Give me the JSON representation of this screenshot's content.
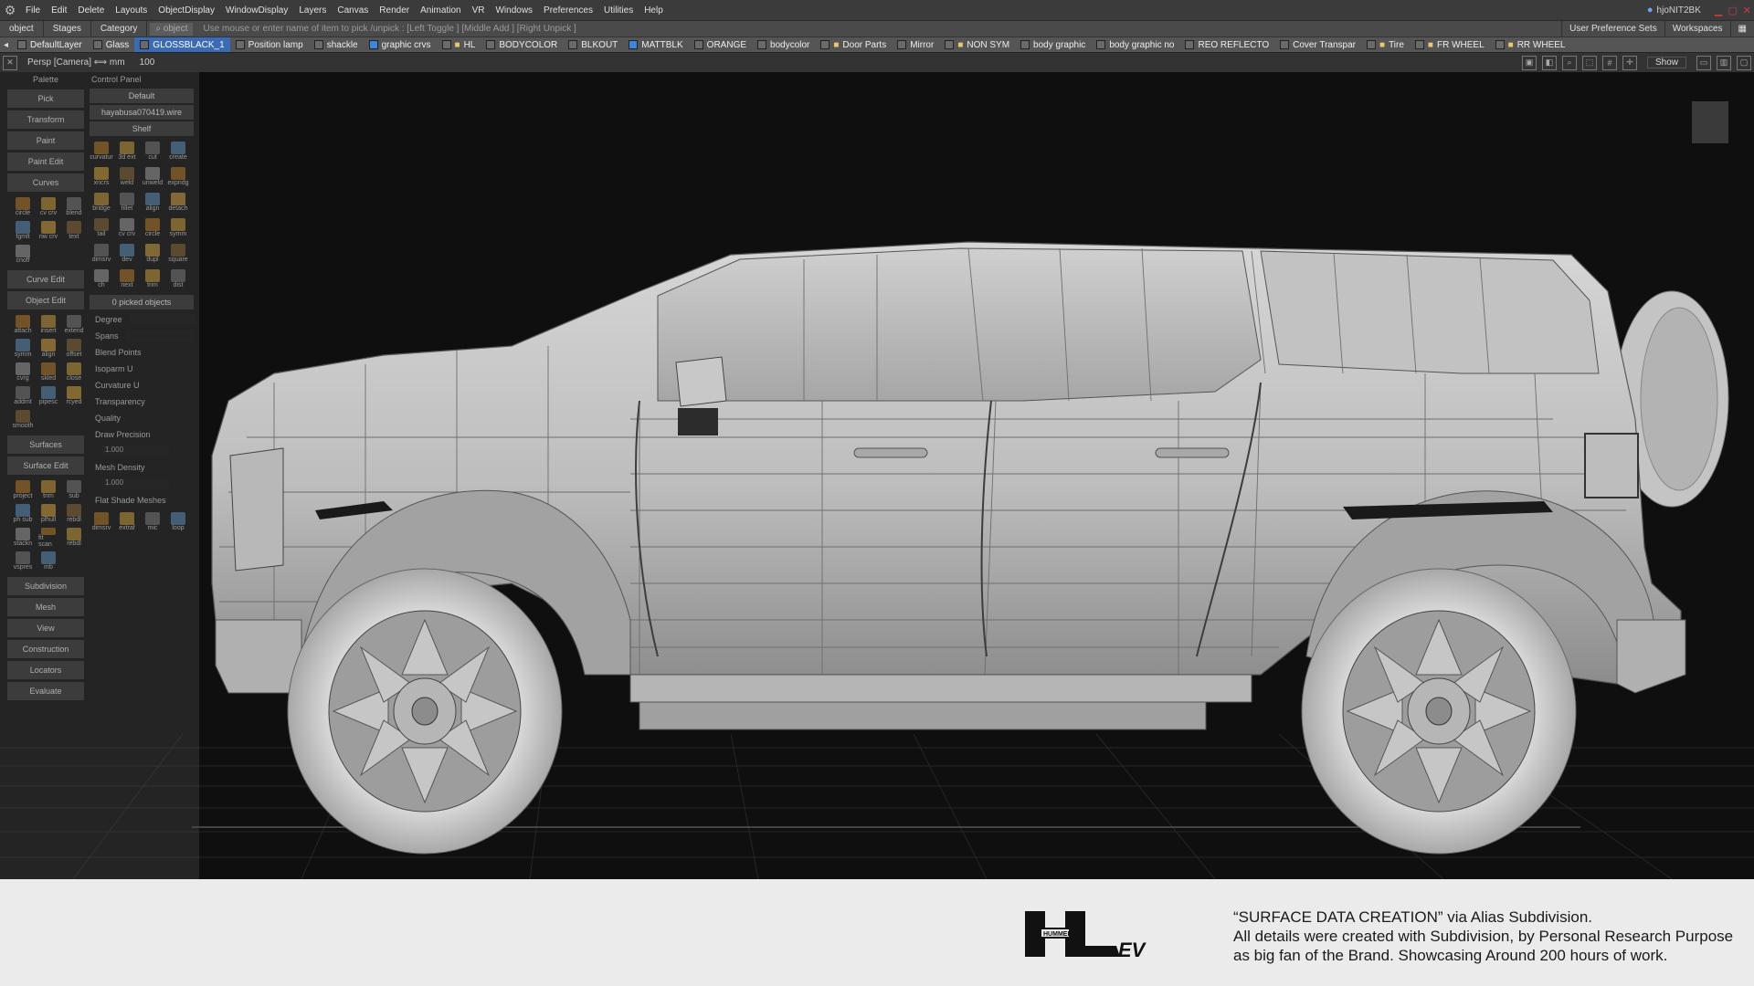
{
  "menubar": {
    "app_icon": "alias-app-icon",
    "items": [
      "File",
      "Edit",
      "Delete",
      "Layouts",
      "ObjectDisplay",
      "WindowDisplay",
      "Layers",
      "Canvas",
      "Render",
      "Animation",
      "VR",
      "Windows",
      "Preferences",
      "Utilities",
      "Help"
    ],
    "user": "hjoNIT2BK"
  },
  "statusbar": {
    "object_label": "object",
    "stages": "Stages",
    "category": "Category",
    "object_field": "object",
    "prompt": "Use mouse or enter name of item to pick /unpick : [Left Toggle ] [Middle Add ] [Right Unpick ]",
    "user_preference_sets": "User Preference Sets",
    "workspaces": "Workspaces"
  },
  "layers": [
    {
      "name": "DefaultLayer",
      "cb": "gray",
      "folder": false,
      "active": false
    },
    {
      "name": "Glass",
      "cb": "gray",
      "folder": false,
      "active": false
    },
    {
      "name": "GLOSSBLACK_1",
      "cb": "gray",
      "folder": false,
      "active": true
    },
    {
      "name": "Position lamp",
      "cb": "gray",
      "folder": false,
      "active": false
    },
    {
      "name": "shackle",
      "cb": "gray",
      "folder": false,
      "active": false
    },
    {
      "name": "graphic crvs",
      "cb": "blue",
      "folder": false,
      "active": false
    },
    {
      "name": "HL",
      "cb": "gray",
      "folder": true,
      "active": false
    },
    {
      "name": "BODYCOLOR",
      "cb": "gray",
      "folder": false,
      "active": false
    },
    {
      "name": "BLKOUT",
      "cb": "gray",
      "folder": false,
      "active": false
    },
    {
      "name": "MATTBLK",
      "cb": "blue",
      "folder": false,
      "active": false
    },
    {
      "name": "ORANGE",
      "cb": "gray",
      "folder": false,
      "active": false
    },
    {
      "name": "bodycolor",
      "cb": "gray",
      "folder": false,
      "active": false
    },
    {
      "name": "Door Parts",
      "cb": "gray",
      "folder": true,
      "active": false
    },
    {
      "name": "Mirror",
      "cb": "gray",
      "folder": false,
      "active": false
    },
    {
      "name": "NON SYM",
      "cb": "gray",
      "folder": true,
      "active": false
    },
    {
      "name": "body graphic",
      "cb": "gray",
      "folder": false,
      "active": false
    },
    {
      "name": "body graphic no",
      "cb": "gray",
      "folder": false,
      "active": false
    },
    {
      "name": "REO REFLECTO",
      "cb": "gray",
      "folder": false,
      "active": false
    },
    {
      "name": "Cover Transpar",
      "cb": "gray",
      "folder": false,
      "active": false
    },
    {
      "name": "Tire",
      "cb": "gray",
      "folder": true,
      "active": false
    },
    {
      "name": "FR WHEEL",
      "cb": "gray",
      "folder": true,
      "active": false
    },
    {
      "name": "RR WHEEL",
      "cb": "gray",
      "folder": true,
      "active": false
    }
  ],
  "viewbar": {
    "camera": "Persp [Camera] ⟺ mm",
    "zoom": "100",
    "show": "Show"
  },
  "palette": {
    "header": "Palette",
    "sections": [
      "Pick",
      "Transform",
      "Paint",
      "Paint Edit",
      "Curves",
      "Curve Edit",
      "Object Edit",
      "Surfaces",
      "Surface Edit",
      "Subdivision",
      "Mesh",
      "View",
      "Construction",
      "Locators",
      "Evaluate"
    ],
    "curves_icons": [
      "circle",
      "cv crv",
      "blend",
      "fgmlt",
      "nw crv",
      "text",
      "cnoff"
    ],
    "object_edit_icons": [
      "attach",
      "insert",
      "extend",
      "symm",
      "align",
      "offset",
      "cvrg",
      "skled",
      "close",
      "addmt",
      "pipesc",
      "rcyed",
      "smooth"
    ],
    "surface_edit_icons": [
      "project",
      "trim",
      "sub",
      "ph sub",
      "plhull",
      "rebdl",
      "stackn",
      "fit scan",
      "rebdl",
      "vspres",
      "mb"
    ]
  },
  "control_panel": {
    "header": "Control Panel",
    "default": "Default",
    "file": "hayabusa070419.wire",
    "shelf": "Shelf",
    "shelf_icons": [
      "curvatur",
      "3d ext",
      "cut",
      "create",
      "xncrs",
      "weld",
      "unweld",
      "expndg",
      "bridge",
      "fillet",
      "align",
      "detach",
      "tail",
      "cv crv",
      "circle",
      "symm",
      "dimsrv",
      "dev",
      "dupl",
      "square",
      "ch",
      "next",
      "trim",
      "dist"
    ],
    "picked": "0 picked objects",
    "degree": "Degree",
    "spans": "Spans",
    "blend_points": "Blend Points",
    "isoparm": "Isoparm U",
    "curvature": "Curvature U",
    "transparency": "Transparency",
    "quality": "Quality",
    "draw_precision": "Draw Precision",
    "draw_precision_value": "1.000",
    "mesh_density": "Mesh Density",
    "mesh_density_value": "1.000",
    "flat_shade": "Flat Shade Meshes",
    "bottom_icons": [
      "dimsrv",
      "extraf",
      "mic",
      "loop"
    ]
  },
  "caption": {
    "logo_text": "HUMMER",
    "logo_suffix": "EV",
    "line1": "“SURFACE DATA CREATION” via Alias Subdivision.",
    "line2": "All details were created with Subdivision, by Personal Research Purpose",
    "line3": "as big fan of the Brand. Showcasing Around 200 hours of work."
  },
  "colors": {
    "menubar": "#3b3b3b",
    "viewport": "#0f0f0f",
    "active_layer": "#3a6bb4",
    "caption_bg": "#ebebeb",
    "model": "#c9c9c9"
  }
}
